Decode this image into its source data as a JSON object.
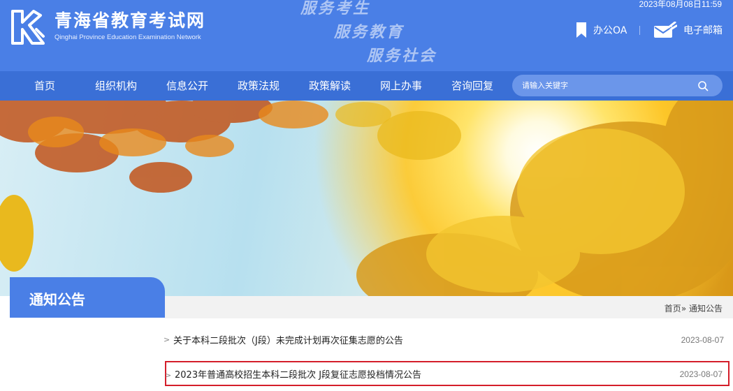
{
  "header": {
    "site_title": "青海省教育考试网",
    "site_subtitle": "Qinghai Province Education Examination Network",
    "slogans": [
      "服务考生",
      "服务教育",
      "服务社会"
    ],
    "datetime": "2023年08月08日11:59",
    "links": {
      "oa": "办公OA",
      "mail": "电子邮箱"
    }
  },
  "nav": {
    "items": [
      "首页",
      "组织机构",
      "信息公开",
      "政策法规",
      "政策解读",
      "网上办事",
      "咨询回复"
    ],
    "search_placeholder": "请输入关键字"
  },
  "section": {
    "title": "通知公告",
    "breadcrumb": {
      "home": "首页",
      "separator": "»",
      "current": "通知公告"
    }
  },
  "notices": [
    {
      "title": "关于本科二段批次（J段）未完成计划再次征集志愿的公告",
      "date": "2023-08-07"
    },
    {
      "title": "2023年普通高校招生本科二段批次 J段复征志愿投档情况公告",
      "date": "2023-08-07"
    }
  ],
  "colors": {
    "header_blue": "#4a7fe6",
    "nav_blue": "#3a6fd6",
    "highlight_border": "#d41e2a"
  }
}
